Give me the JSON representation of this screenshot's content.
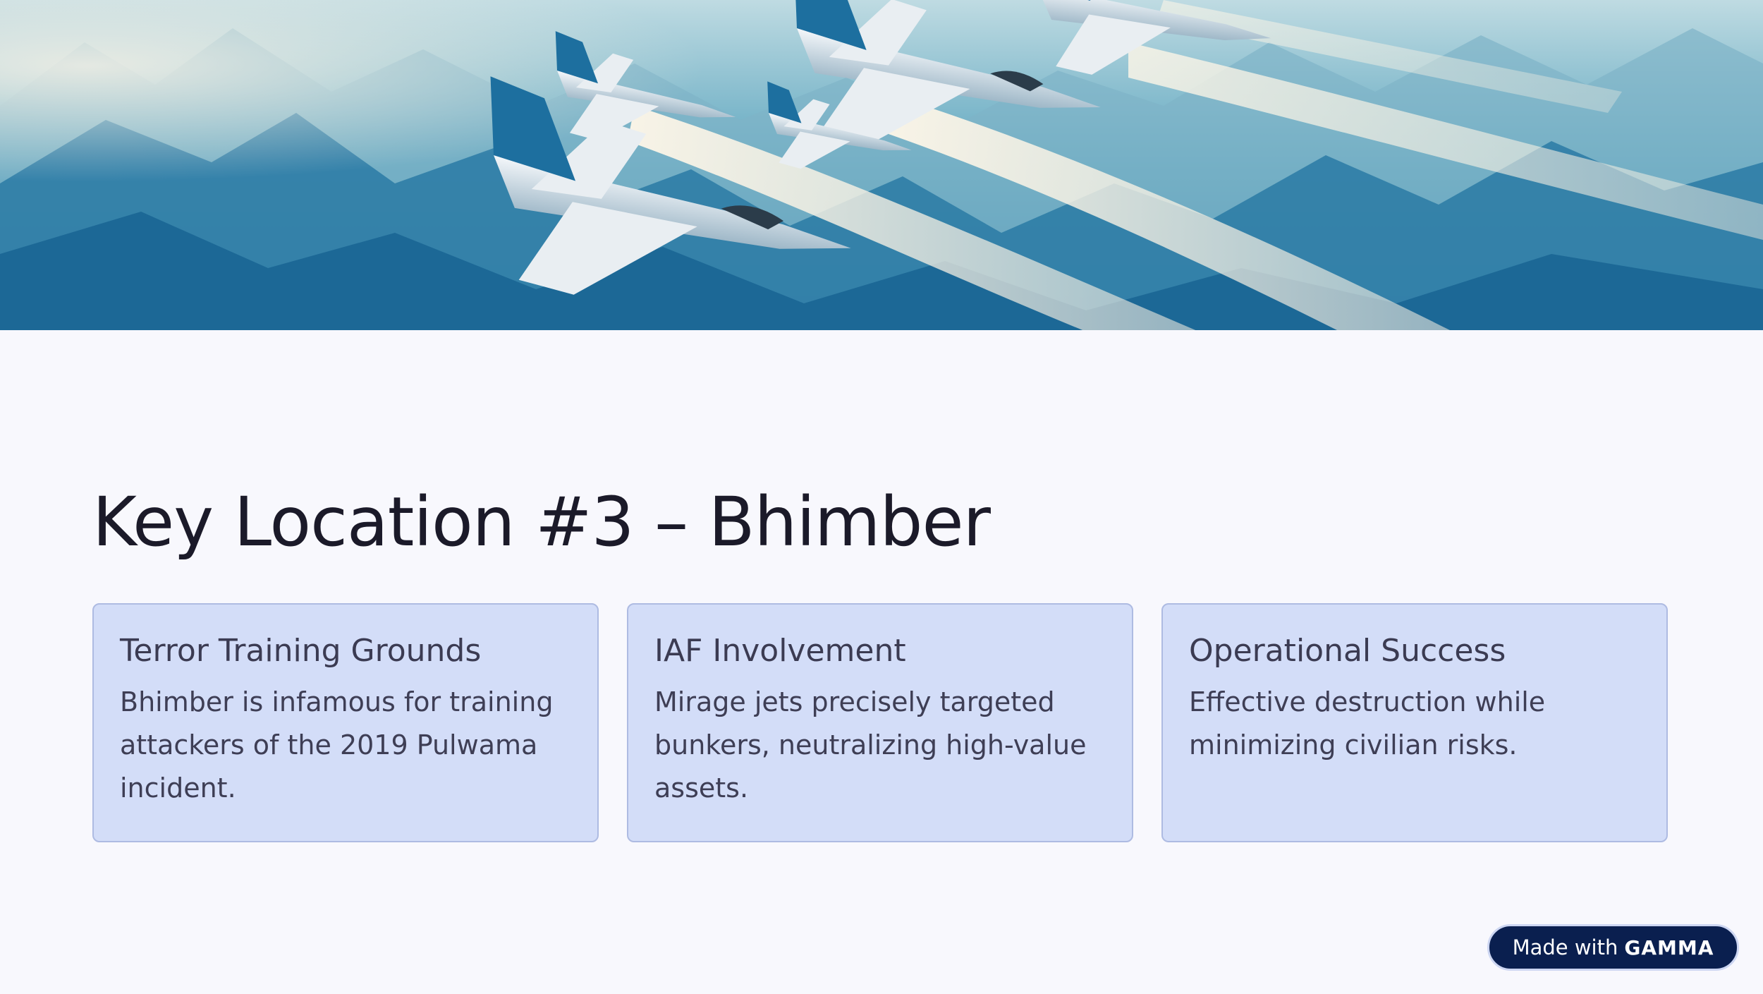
{
  "hero": {
    "image": "fighter-jets-over-mountains"
  },
  "slide": {
    "title": "Key Location #3 – Bhimber"
  },
  "cards": [
    {
      "title": "Terror Training Grounds",
      "body": "Bhimber is infamous for training attackers of the 2019 Pulwama incident."
    },
    {
      "title": "IAF Involvement",
      "body": "Mirage jets precisely targeted bunkers, neutralizing high-value assets."
    },
    {
      "title": "Operational Success",
      "body": "Effective destruction while minimizing civilian risks."
    }
  ],
  "badge": {
    "prefix": "Made with",
    "brand": "GAMMA"
  },
  "colors": {
    "background": "#f8f8fd",
    "card_fill": "#d3ddf8",
    "card_border": "#aebbe2",
    "title": "#1b1a29",
    "badge_fill": "#0a1f4f"
  }
}
